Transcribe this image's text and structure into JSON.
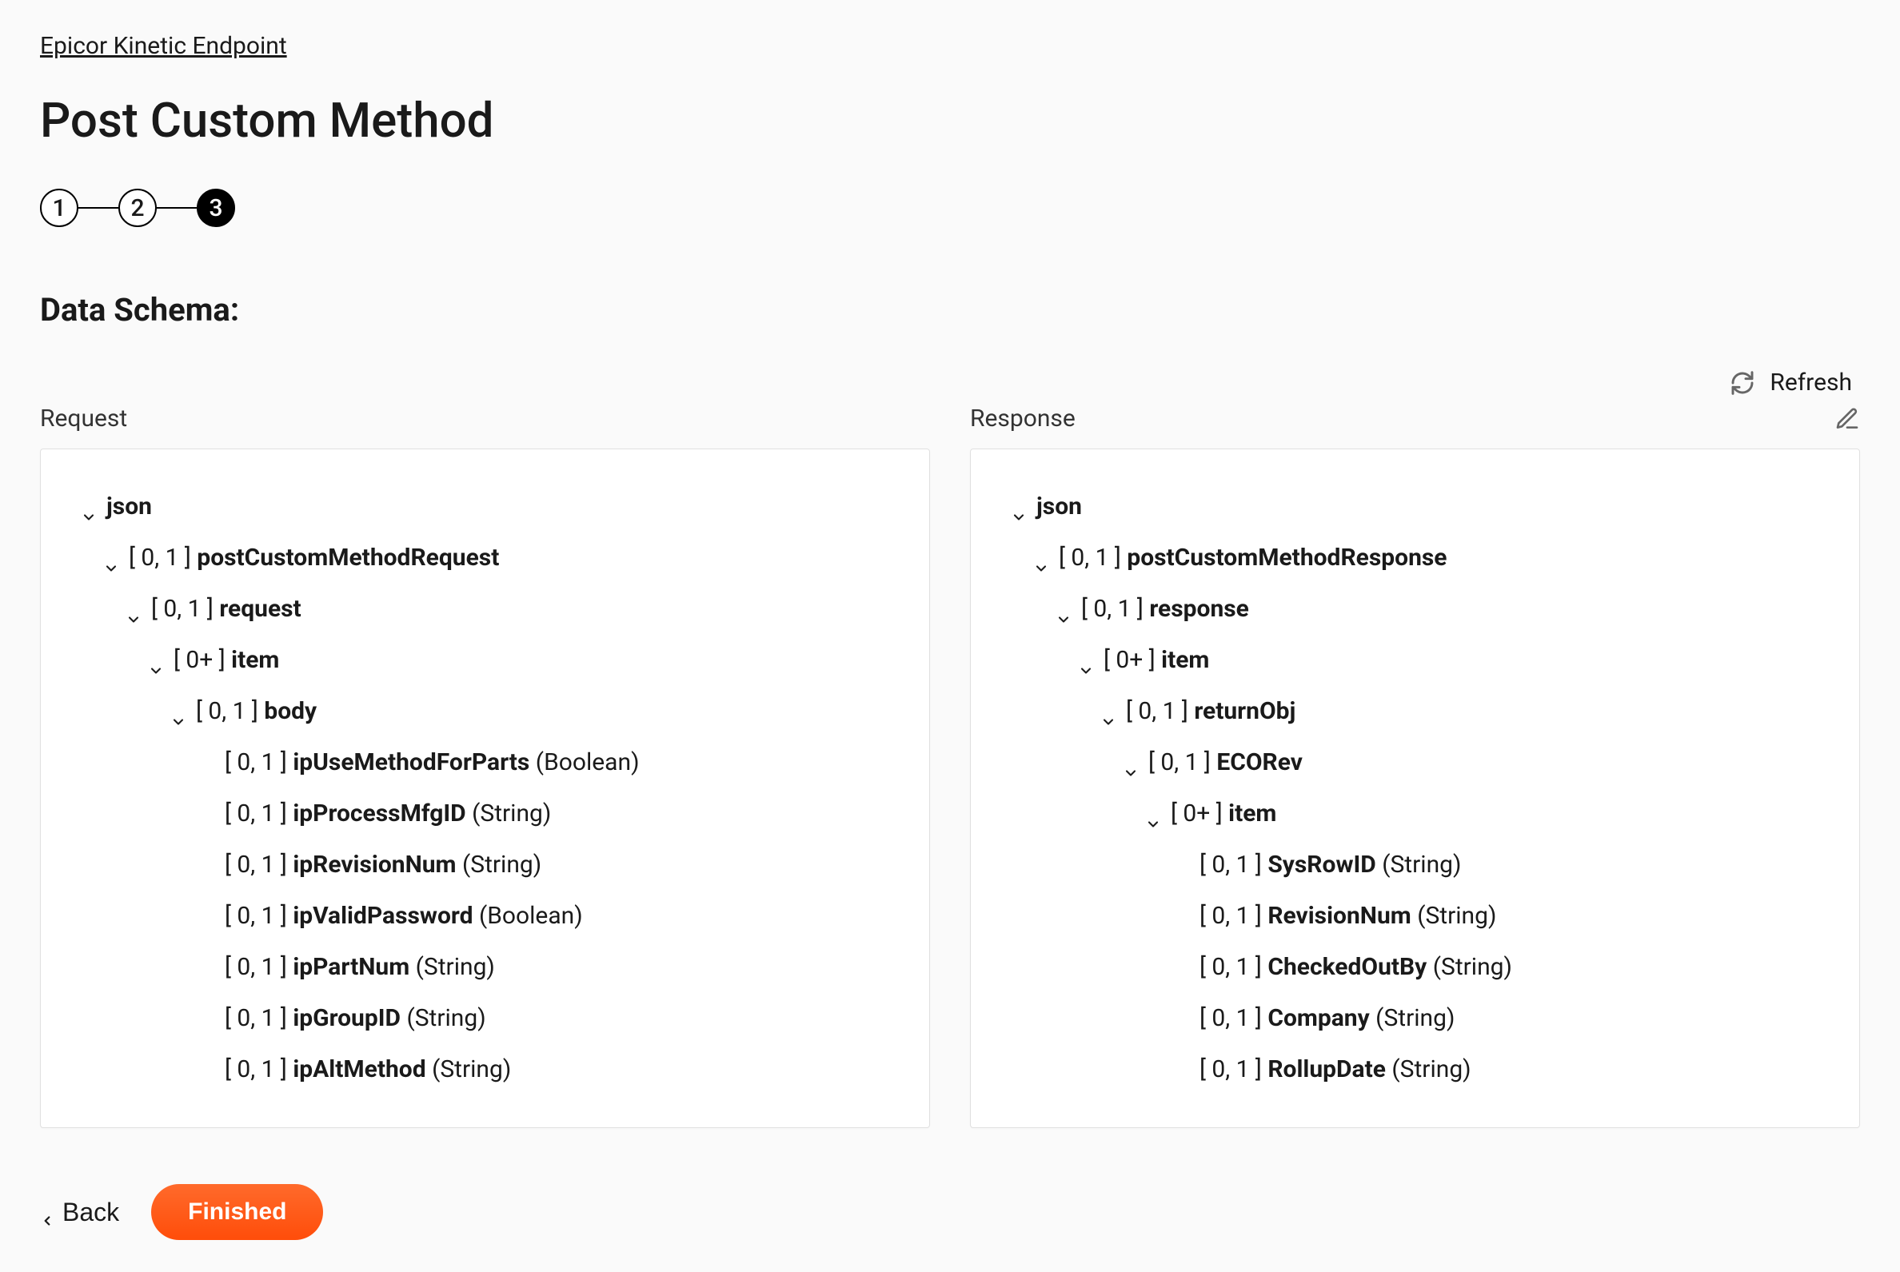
{
  "breadcrumb": "Epicor Kinetic Endpoint",
  "title": "Post Custom Method",
  "stepper": {
    "steps": [
      "1",
      "2",
      "3"
    ],
    "active_index": 2
  },
  "schema_heading": "Data Schema:",
  "refresh_label": "Refresh",
  "columns": {
    "request": {
      "title": "Request",
      "tree": [
        {
          "indent": 0,
          "chevron": true,
          "card": "",
          "name": "json",
          "type": ""
        },
        {
          "indent": 1,
          "chevron": true,
          "card": "[ 0, 1 ]",
          "name": "postCustomMethodRequest",
          "type": ""
        },
        {
          "indent": 2,
          "chevron": true,
          "card": "[ 0, 1 ]",
          "name": "request",
          "type": ""
        },
        {
          "indent": 3,
          "chevron": true,
          "card": "[ 0+ ]",
          "name": "item",
          "type": ""
        },
        {
          "indent": 4,
          "chevron": true,
          "card": "[ 0, 1 ]",
          "name": "body",
          "type": ""
        },
        {
          "indent": 5,
          "chevron": false,
          "card": "[ 0, 1 ]",
          "name": "ipUseMethodForParts",
          "type": "(Boolean)"
        },
        {
          "indent": 5,
          "chevron": false,
          "card": "[ 0, 1 ]",
          "name": "ipProcessMfgID",
          "type": "(String)"
        },
        {
          "indent": 5,
          "chevron": false,
          "card": "[ 0, 1 ]",
          "name": "ipRevisionNum",
          "type": "(String)"
        },
        {
          "indent": 5,
          "chevron": false,
          "card": "[ 0, 1 ]",
          "name": "ipValidPassword",
          "type": "(Boolean)"
        },
        {
          "indent": 5,
          "chevron": false,
          "card": "[ 0, 1 ]",
          "name": "ipPartNum",
          "type": "(String)"
        },
        {
          "indent": 5,
          "chevron": false,
          "card": "[ 0, 1 ]",
          "name": "ipGroupID",
          "type": "(String)"
        },
        {
          "indent": 5,
          "chevron": false,
          "card": "[ 0, 1 ]",
          "name": "ipAltMethod",
          "type": "(String)"
        }
      ]
    },
    "response": {
      "title": "Response",
      "tree": [
        {
          "indent": 0,
          "chevron": true,
          "card": "",
          "name": "json",
          "type": ""
        },
        {
          "indent": 1,
          "chevron": true,
          "card": "[ 0, 1 ]",
          "name": "postCustomMethodResponse",
          "type": ""
        },
        {
          "indent": 2,
          "chevron": true,
          "card": "[ 0, 1 ]",
          "name": "response",
          "type": ""
        },
        {
          "indent": 3,
          "chevron": true,
          "card": "[ 0+ ]",
          "name": "item",
          "type": ""
        },
        {
          "indent": 4,
          "chevron": true,
          "card": "[ 0, 1 ]",
          "name": "returnObj",
          "type": ""
        },
        {
          "indent": 5,
          "chevron": true,
          "card": "[ 0, 1 ]",
          "name": "ECORev",
          "type": ""
        },
        {
          "indent": 6,
          "chevron": true,
          "card": "[ 0+ ]",
          "name": "item",
          "type": ""
        },
        {
          "indent": 7,
          "chevron": false,
          "card": "[ 0, 1 ]",
          "name": "SysRowID",
          "type": "(String)"
        },
        {
          "indent": 7,
          "chevron": false,
          "card": "[ 0, 1 ]",
          "name": "RevisionNum",
          "type": "(String)"
        },
        {
          "indent": 7,
          "chevron": false,
          "card": "[ 0, 1 ]",
          "name": "CheckedOutBy",
          "type": "(String)"
        },
        {
          "indent": 7,
          "chevron": false,
          "card": "[ 0, 1 ]",
          "name": "Company",
          "type": "(String)"
        },
        {
          "indent": 7,
          "chevron": false,
          "card": "[ 0, 1 ]",
          "name": "RollupDate",
          "type": "(String)"
        }
      ]
    }
  },
  "footer": {
    "back": "Back",
    "finished": "Finished"
  }
}
